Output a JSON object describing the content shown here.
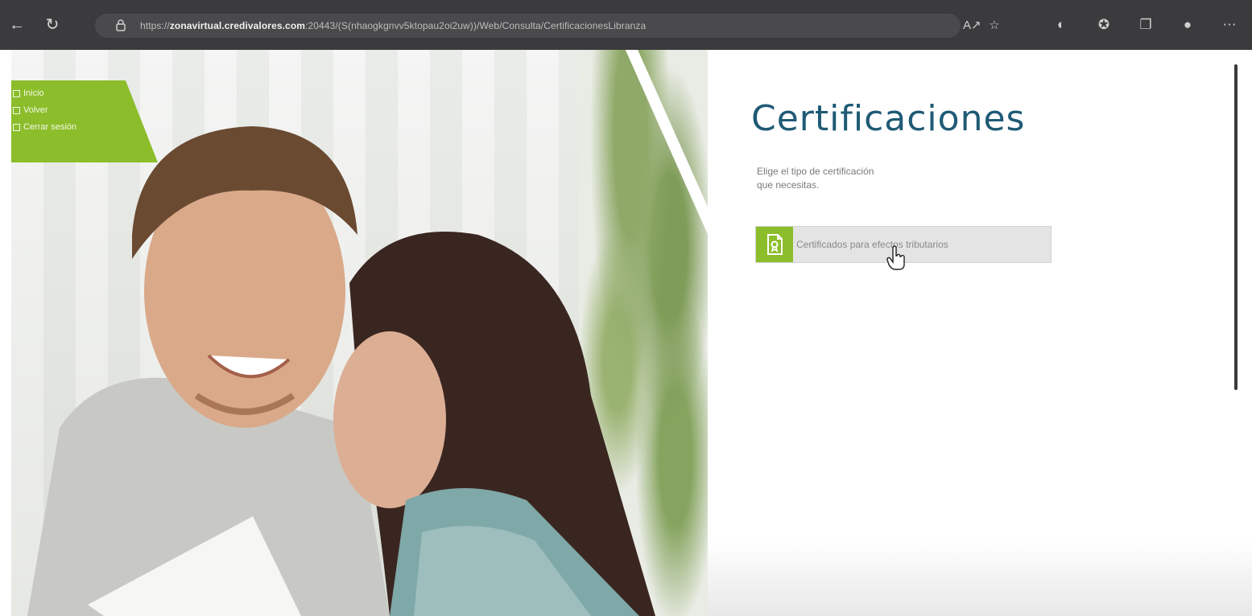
{
  "browser": {
    "url_prefix": "https://",
    "url_host": "zonavirtual.credivalores.com",
    "url_rest": ":20443/(S(nhaogkgnvv5ktopau2oi2uw))/Web/Consulta/CertificacionesLibranza"
  },
  "nav": {
    "items": [
      "Inicio",
      "Volver",
      "Cerrar sesión"
    ]
  },
  "main": {
    "title": "Certificaciones",
    "subtitle_line1": "Elige el tipo de certificación",
    "subtitle_line2": "que necesitas.",
    "cert_button_label": "Certificados para efectos tributarios"
  },
  "colors": {
    "accent_green": "#8cbd2a",
    "title_blue": "#1f5a75"
  }
}
